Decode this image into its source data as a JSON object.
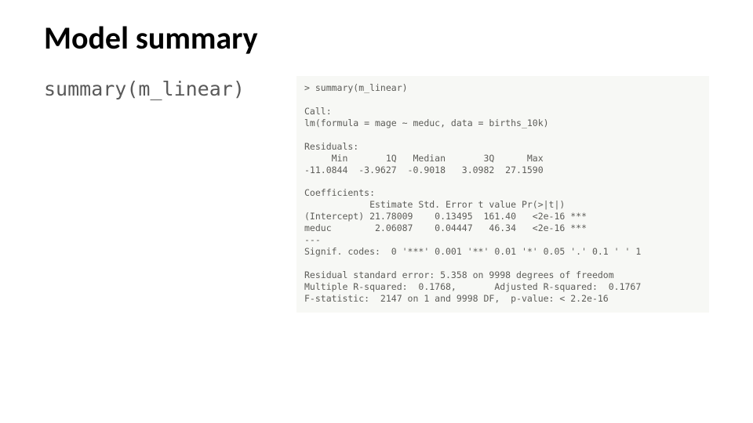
{
  "title": "Model summary",
  "command": "summary(m_linear)",
  "console": "> summary(m_linear)\n\nCall:\nlm(formula = mage ~ meduc, data = births_10k)\n\nResiduals:\n     Min       1Q   Median       3Q      Max\n-11.0844  -3.9627  -0.9018   3.0982  27.1590\n\nCoefficients:\n            Estimate Std. Error t value Pr(>|t|)\n(Intercept) 21.78009    0.13495  161.40   <2e-16 ***\nmeduc        2.06087    0.04447   46.34   <2e-16 ***\n---\nSignif. codes:  0 '***' 0.001 '**' 0.01 '*' 0.05 '.' 0.1 ' ' 1\n\nResidual standard error: 5.358 on 9998 degrees of freedom\nMultiple R-squared:  0.1768,       Adjusted R-squared:  0.1767\nF-statistic:  2147 on 1 and 9998 DF,  p-value: < 2.2e-16"
}
